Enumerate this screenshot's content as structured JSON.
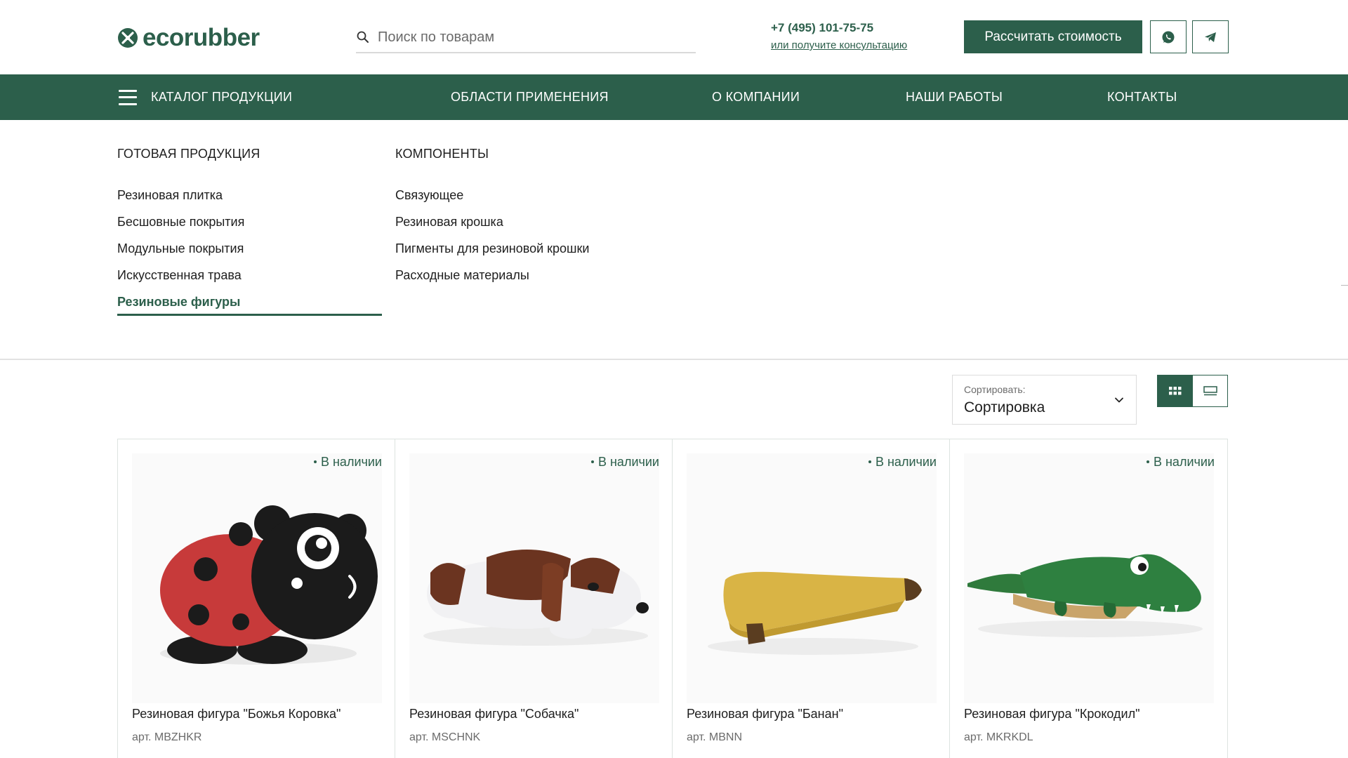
{
  "header": {
    "logo_text": "ecorubber",
    "search_placeholder": "Поиск по товарам",
    "phone": "+7 (495) 101-75-75",
    "consult_link": "или получите консультацию",
    "cta_label": "Рассчитать стоимость",
    "brand_color": "#2c5f4b"
  },
  "nav": {
    "items": [
      {
        "label": "КАТАЛОГ ПРОДУКЦИИ"
      },
      {
        "label": "ОБЛАСТИ ПРИМЕНЕНИЯ"
      },
      {
        "label": "О КОМПАНИИ"
      },
      {
        "label": "НАШИ РАБОТЫ"
      },
      {
        "label": "КОНТАКТЫ"
      }
    ]
  },
  "mega_menu": {
    "col1_title": "ГОТОВАЯ ПРОДУКЦИЯ",
    "col1_items": [
      "Резиновая плитка",
      "Бесшовные покрытия",
      "Модульные покрытия",
      "Искусственная трава",
      "Резиновые фигуры"
    ],
    "col2_title": "КОМПОНЕНТЫ",
    "col2_items": [
      "Связующее",
      "Резиновая крошка",
      "Пигменты для резиновой крошки",
      "Расходные материалы"
    ]
  },
  "sort": {
    "label": "Сортировать:",
    "value": "Сортировка"
  },
  "products": [
    {
      "title": "Резиновая фигура \"Божья Коровка\"",
      "sku": "арт. MBZHKR",
      "stock": "В наличии",
      "icon": "ladybug-figure-image"
    },
    {
      "title": "Резиновая фигура \"Собачка\"",
      "sku": "арт. MSCHNK",
      "stock": "В наличии",
      "icon": "dog-figure-image"
    },
    {
      "title": "Резиновая фигура \"Банан\"",
      "sku": "арт. MBNN",
      "stock": "В наличии",
      "icon": "banana-figure-image"
    },
    {
      "title": "Резиновая фигура \"Крокодил\"",
      "sku": "арт. MKRKDL",
      "stock": "В наличии",
      "icon": "crocodile-figure-image"
    }
  ]
}
